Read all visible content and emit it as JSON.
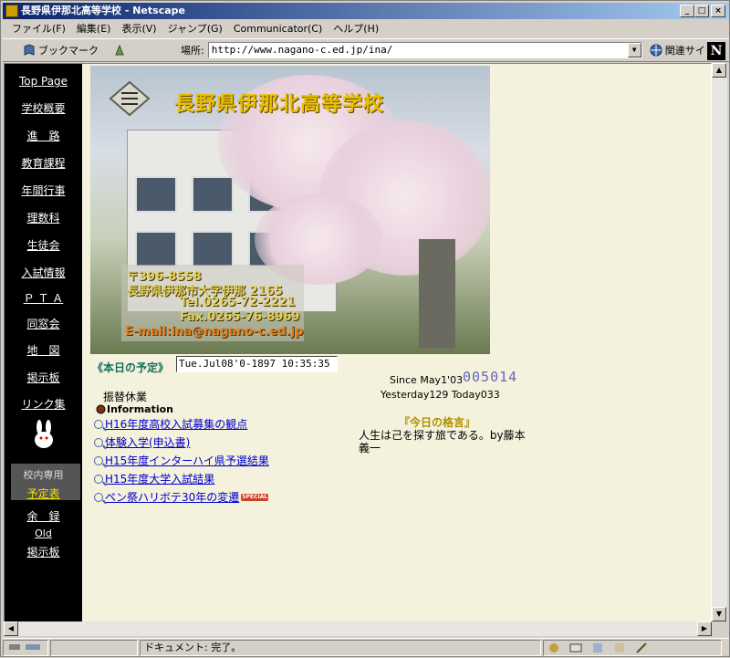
{
  "window": {
    "title": "長野県伊那北高等学校 - Netscape",
    "minimize": "_",
    "maximize": "□",
    "close": "×"
  },
  "menu": [
    "ファイル(F)",
    "編集(E)",
    "表示(V)",
    "ジャンプ(G)",
    "Communicator(C)",
    "ヘルプ(H)"
  ],
  "toolbar": {
    "bookmarks": "ブックマーク",
    "location_label": "場所:",
    "url": "http://www.nagano-c.ed.jp/ina/",
    "related": "関連サイト",
    "logo": "N"
  },
  "sidebar": {
    "items": [
      "Top Page",
      "学校概要",
      "進　路",
      "教育課程",
      "年間行事",
      "理数科",
      "生徒会",
      "入試情報",
      "Ｐ Ｔ Ａ",
      "同窓会",
      "地　図",
      "掲示板",
      "リンク集"
    ],
    "school_only_label": "校内専用",
    "school_only_link": "予定表",
    "yoroku": "余　録",
    "old_label": "Old",
    "old_board": "掲示板"
  },
  "banner": {
    "title": "長野県伊那北高等学校",
    "postal": "〒396-8558",
    "address": "長野県伊那市大字伊那 2165",
    "tel": "Tel.0265-72-2221",
    "fax": "Fax.0265-76-8969",
    "email": "E-mail:ina@nagano-c.ed.jp"
  },
  "schedule": {
    "label": "《本日の予定》",
    "clock": "Tue.Jul08'0-1897 10:35:35",
    "event": "振替休業"
  },
  "counter": {
    "since": "Since May1'03",
    "value": "005014",
    "yesterday_today": "Yesterday129 Today033"
  },
  "info": {
    "heading": "Information",
    "links": [
      "H16年度高校入試募集の観点",
      "体験入学(申込書)",
      "H15年度インターハイ県予選結果",
      "H15年度大学入試結果",
      "ペン祭ハリボテ30年の変遷"
    ],
    "special_badge": "SPECIAL"
  },
  "quote": {
    "title": "『今日の格言』",
    "text": "人生は己を探す旅である。by藤本義一"
  },
  "status": {
    "text": "ドキュメント: 完了。"
  }
}
